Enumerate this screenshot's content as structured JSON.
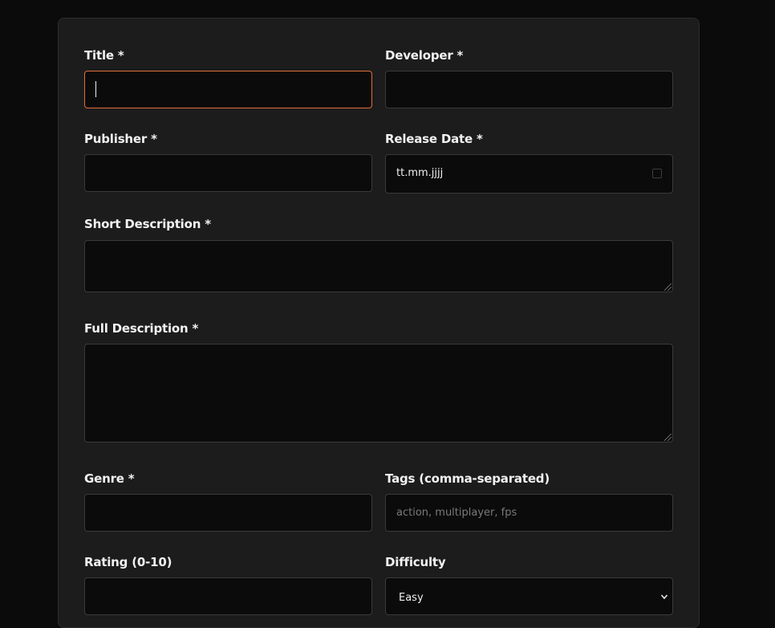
{
  "form": {
    "title": {
      "label": "Title *",
      "value": ""
    },
    "developer": {
      "label": "Developer *",
      "value": ""
    },
    "publisher": {
      "label": "Publisher *",
      "value": ""
    },
    "release_date": {
      "label": "Release Date *",
      "display": "tt.mm.jjjj"
    },
    "short_description": {
      "label": "Short Description *",
      "value": ""
    },
    "full_description": {
      "label": "Full Description *",
      "value": ""
    },
    "genre": {
      "label": "Genre *",
      "value": ""
    },
    "tags": {
      "label": "Tags (comma-separated)",
      "placeholder": "action, multiplayer, fps"
    },
    "rating": {
      "label": "Rating (0-10)",
      "value": ""
    },
    "difficulty": {
      "label": "Difficulty",
      "selected": "Easy"
    }
  },
  "icons": {
    "date_picker": "calendar-icon",
    "select_arrow": "chevron-down-icon"
  },
  "colors": {
    "focus_border": "#e0703c",
    "card_bg": "#1c1c1c",
    "field_bg": "#0b0b0b",
    "page_bg": "#0b0b0b"
  }
}
